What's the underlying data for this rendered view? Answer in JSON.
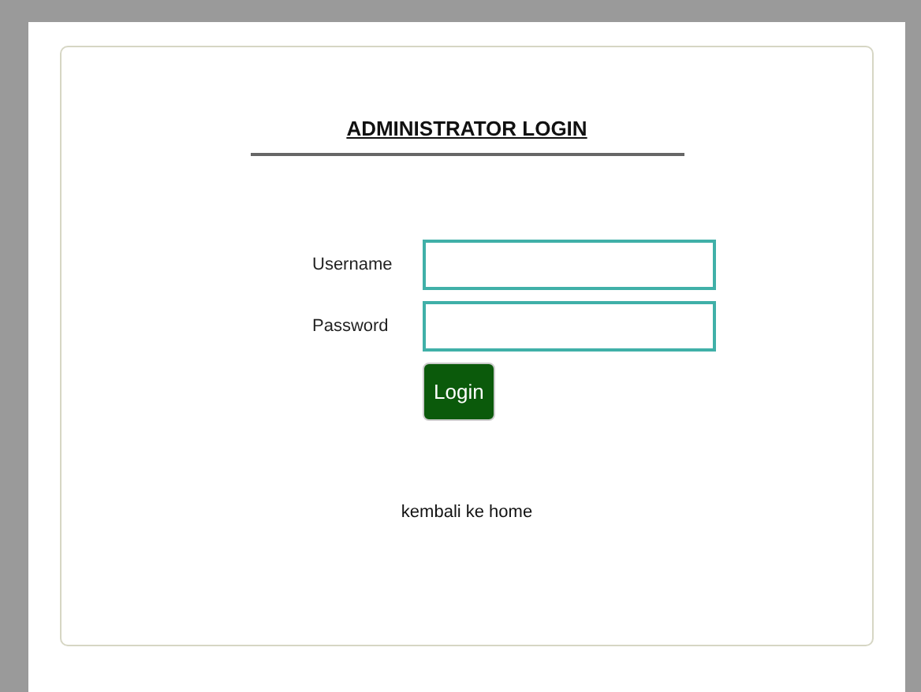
{
  "title": "ADMINISTRATOR LOGIN",
  "fields": [
    {
      "label": "Username"
    },
    {
      "label": "Password"
    }
  ],
  "button": "Login",
  "link": "kembali ke home"
}
